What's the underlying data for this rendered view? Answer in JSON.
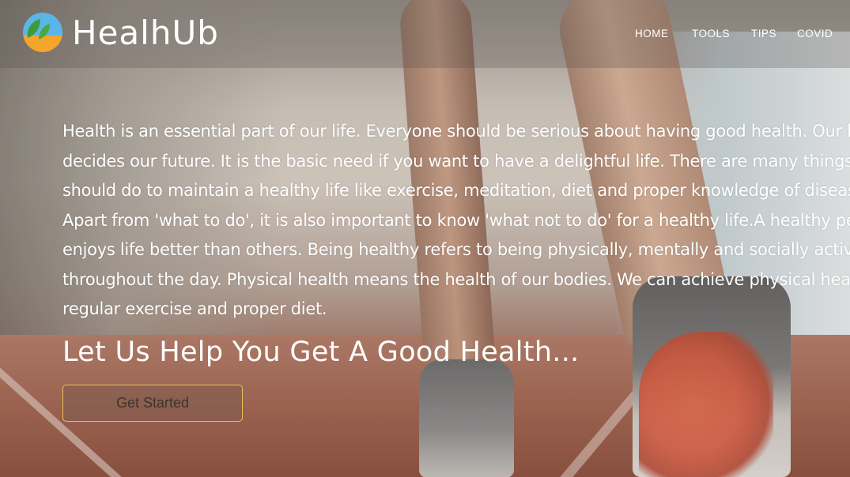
{
  "brand": {
    "name": "HealhUb",
    "logo_icon": "leaf-logo-icon"
  },
  "nav": {
    "items": [
      {
        "label": "HOME"
      },
      {
        "label": "TOOLS"
      },
      {
        "label": "TIPS"
      },
      {
        "label": "COVID"
      }
    ]
  },
  "main": {
    "paragraph_lines": [
      "Health is an essential part of our life. Everyone should be serious about having good health. Our h",
      "decides our future. It is the basic need if you want to have a delightful life. There are many things",
      "should do to maintain a healthy life like exercise, meditation, diet and proper knowledge of diseas",
      "Apart from 'what to do', it is also important to know 'what not to do' for a healthy life.A healthy pe",
      "enjoys life better than others. Being healthy refers to being physically, mentally and socially active",
      "throughout the day. Physical health means the health of our bodies. We can achieve physical hea",
      "regular exercise and proper diet."
    ],
    "headline": "Let Us Help You Get A Good Health...",
    "cta_label": "Get Started"
  },
  "colors": {
    "cta_border": "#e7c15a",
    "logo_blue": "#5ab6e8",
    "logo_orange": "#f4a52b",
    "logo_leaf": "#3f9b3a"
  }
}
